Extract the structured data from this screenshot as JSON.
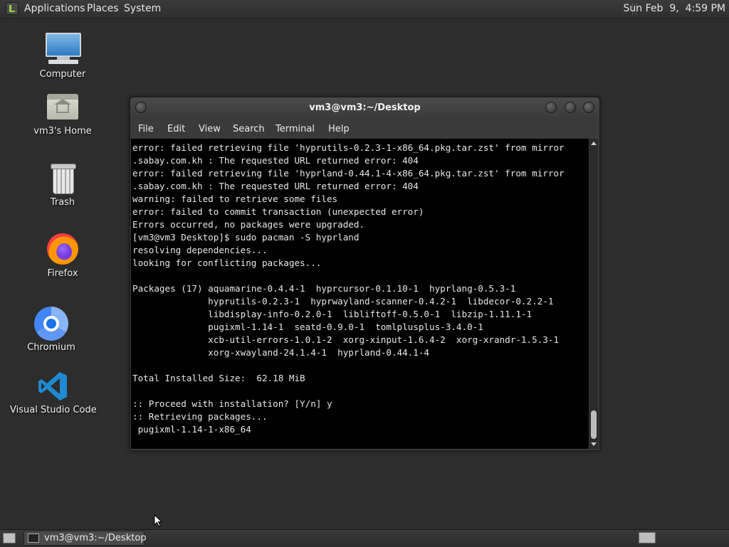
{
  "top_panel": {
    "menus": [
      "Applications",
      "Places",
      "System"
    ],
    "clock": "Sun Feb  9,  4:59 PM"
  },
  "desktop_icons": [
    {
      "label": "Computer",
      "icon": "computer-icon"
    },
    {
      "label": "vm3's Home",
      "icon": "home-folder-icon"
    },
    {
      "label": "Trash",
      "icon": "trash-icon"
    },
    {
      "label": "Firefox",
      "icon": "firefox-icon"
    },
    {
      "label": "Chromium",
      "icon": "chromium-icon"
    },
    {
      "label": "Visual Studio Code",
      "icon": "vscode-icon"
    }
  ],
  "terminal": {
    "title": "vm3@vm3:~/Desktop",
    "menu": [
      "File",
      "Edit",
      "View",
      "Search",
      "Terminal",
      "Help"
    ],
    "lines": [
      "error: failed retrieving file 'hyprutils-0.2.3-1-x86_64.pkg.tar.zst' from mirror",
      ".sabay.com.kh : The requested URL returned error: 404",
      "error: failed retrieving file 'hyprland-0.44.1-4-x86_64.pkg.tar.zst' from mirror",
      ".sabay.com.kh : The requested URL returned error: 404",
      "warning: failed to retrieve some files",
      "error: failed to commit transaction (unexpected error)",
      "Errors occurred, no packages were upgraded.",
      "[vm3@vm3 Desktop]$ sudo pacman -S hyprland",
      "resolving dependencies...",
      "looking for conflicting packages...",
      "",
      "Packages (17) aquamarine-0.4.4-1  hyprcursor-0.1.10-1  hyprlang-0.5.3-1",
      "              hyprutils-0.2.3-1  hyprwayland-scanner-0.4.2-1  libdecor-0.2.2-1",
      "              libdisplay-info-0.2.0-1  libliftoff-0.5.0-1  libzip-1.11.1-1",
      "              pugixml-1.14-1  seatd-0.9.0-1  tomlplusplus-3.4.0-1",
      "              xcb-util-errors-1.0.1-2  xorg-xinput-1.6.4-2  xorg-xrandr-1.5.3-1",
      "              xorg-xwayland-24.1.4-1  hyprland-0.44.1-4",
      "",
      "Total Installed Size:  62.18 MiB",
      "",
      ":: Proceed with installation? [Y/n] y",
      ":: Retrieving packages...",
      " pugixml-1.14-1-x86_64"
    ]
  },
  "taskbar": {
    "task_label": "vm3@vm3:~/Desktop"
  }
}
